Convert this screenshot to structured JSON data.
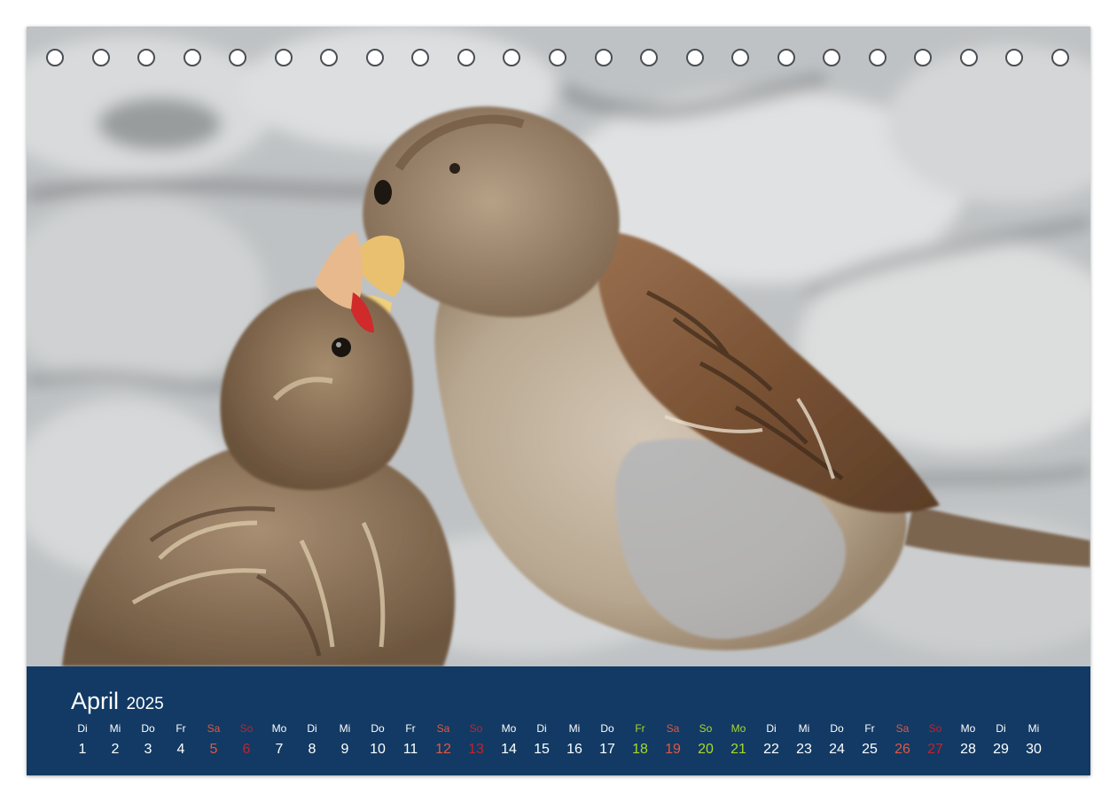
{
  "calendar": {
    "month": "April",
    "year": "2025",
    "photo": {
      "subject": "sparrow-feeding-chick",
      "colors": {
        "background": "#c2c5c7",
        "stone": "#d9dbdc",
        "feather_brown": "#8a6a4c",
        "feather_light": "#cbbba6",
        "beak": "#e8b860"
      }
    },
    "binding_holes": 23,
    "colors": {
      "footer_bg": "#123a64",
      "weekday": "#ffffff",
      "saturday": "#e4573f",
      "sunday": "#c2232c",
      "holiday": "#a9d82b"
    },
    "days": [
      {
        "abbr": "Di",
        "num": "1",
        "kind": "weekday"
      },
      {
        "abbr": "Mi",
        "num": "2",
        "kind": "weekday"
      },
      {
        "abbr": "Do",
        "num": "3",
        "kind": "weekday"
      },
      {
        "abbr": "Fr",
        "num": "4",
        "kind": "weekday"
      },
      {
        "abbr": "Sa",
        "num": "5",
        "kind": "sa"
      },
      {
        "abbr": "So",
        "num": "6",
        "kind": "so"
      },
      {
        "abbr": "Mo",
        "num": "7",
        "kind": "weekday"
      },
      {
        "abbr": "Di",
        "num": "8",
        "kind": "weekday"
      },
      {
        "abbr": "Mi",
        "num": "9",
        "kind": "weekday"
      },
      {
        "abbr": "Do",
        "num": "10",
        "kind": "weekday"
      },
      {
        "abbr": "Fr",
        "num": "11",
        "kind": "weekday"
      },
      {
        "abbr": "Sa",
        "num": "12",
        "kind": "sa"
      },
      {
        "abbr": "So",
        "num": "13",
        "kind": "so"
      },
      {
        "abbr": "Mo",
        "num": "14",
        "kind": "weekday"
      },
      {
        "abbr": "Di",
        "num": "15",
        "kind": "weekday"
      },
      {
        "abbr": "Mi",
        "num": "16",
        "kind": "weekday"
      },
      {
        "abbr": "Do",
        "num": "17",
        "kind": "weekday"
      },
      {
        "abbr": "Fr",
        "num": "18",
        "kind": "holiday"
      },
      {
        "abbr": "Sa",
        "num": "19",
        "kind": "sa"
      },
      {
        "abbr": "So",
        "num": "20",
        "kind": "holiday"
      },
      {
        "abbr": "Mo",
        "num": "21",
        "kind": "holiday"
      },
      {
        "abbr": "Di",
        "num": "22",
        "kind": "weekday"
      },
      {
        "abbr": "Mi",
        "num": "23",
        "kind": "weekday"
      },
      {
        "abbr": "Do",
        "num": "24",
        "kind": "weekday"
      },
      {
        "abbr": "Fr",
        "num": "25",
        "kind": "weekday"
      },
      {
        "abbr": "Sa",
        "num": "26",
        "kind": "sa"
      },
      {
        "abbr": "So",
        "num": "27",
        "kind": "so"
      },
      {
        "abbr": "Mo",
        "num": "28",
        "kind": "weekday"
      },
      {
        "abbr": "Di",
        "num": "29",
        "kind": "weekday"
      },
      {
        "abbr": "Mi",
        "num": "30",
        "kind": "weekday"
      }
    ]
  }
}
